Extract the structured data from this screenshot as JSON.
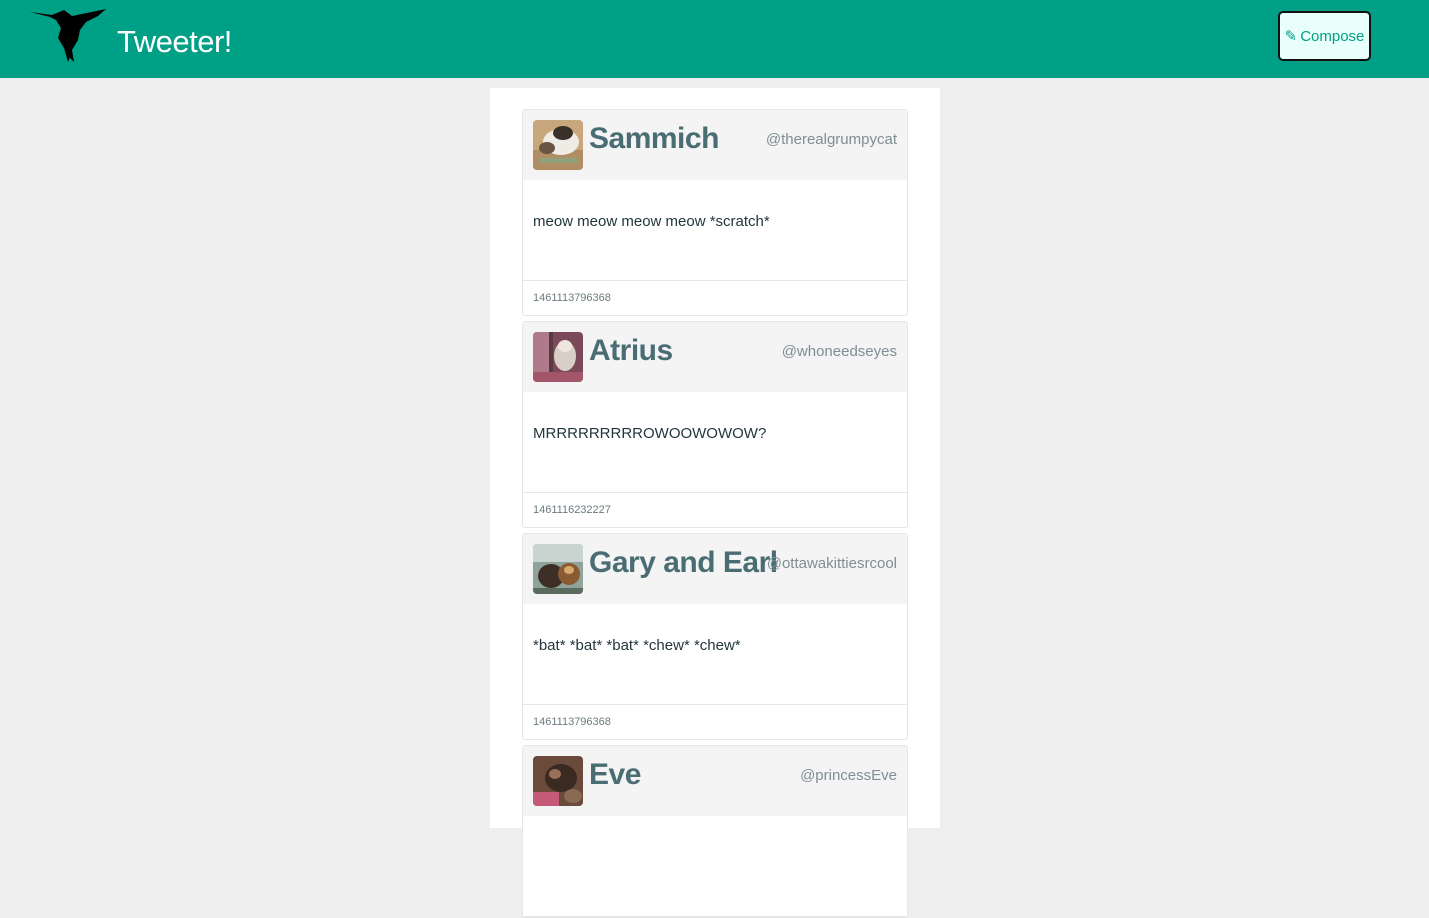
{
  "header": {
    "brand": "Tweeter!",
    "compose_label": "Compose",
    "compose_icon": "✎",
    "logo_icon": "hummingbird-icon"
  },
  "colors": {
    "navbar": "#00a087",
    "name": "#4a6d74",
    "page_bg": "#eeeeee"
  },
  "tweets": [
    {
      "name": "Sammich",
      "handle": "@therealgrumpycat",
      "text": "meow meow meow meow *scratch*",
      "timestamp": "1461113796368"
    },
    {
      "name": "Atrius",
      "handle": "@whoneedseyes",
      "text": "MRRRRRRRRROWOOWOWOW?",
      "timestamp": "1461116232227"
    },
    {
      "name": "Gary and Earl",
      "handle": "@ottawakittiesrcool",
      "text": "*bat* *bat* *bat* *chew* *chew*",
      "timestamp": "1461113796368"
    },
    {
      "name": "Eve",
      "handle": "@princessEve",
      "text": "",
      "timestamp": ""
    }
  ]
}
